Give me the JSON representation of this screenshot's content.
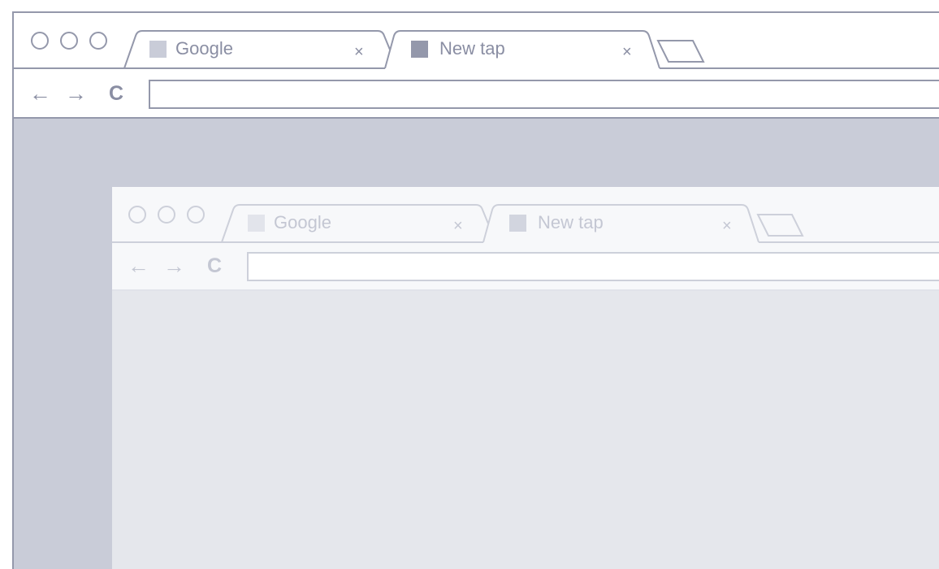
{
  "outer": {
    "tabs": [
      {
        "label": "Google",
        "close": "×",
        "active": false
      },
      {
        "label": "New tap",
        "close": "×",
        "active": true
      }
    ],
    "toolbar": {
      "back": "←",
      "forward": "→",
      "reload": "C"
    }
  },
  "inner": {
    "tabs": [
      {
        "label": "Google",
        "close": "×",
        "active": false
      },
      {
        "label": "New tap",
        "close": "×",
        "active": true
      }
    ],
    "toolbar": {
      "back": "←",
      "forward": "→",
      "reload": "C"
    }
  },
  "colors": {
    "outer_line": "#9498ab",
    "outer_text": "#8a8ea3",
    "outer_fill": "#c9ccd8",
    "inner_line": "#cdd0da",
    "inner_text": "#c4c7d3",
    "inner_fill": "#e5e7ec"
  }
}
